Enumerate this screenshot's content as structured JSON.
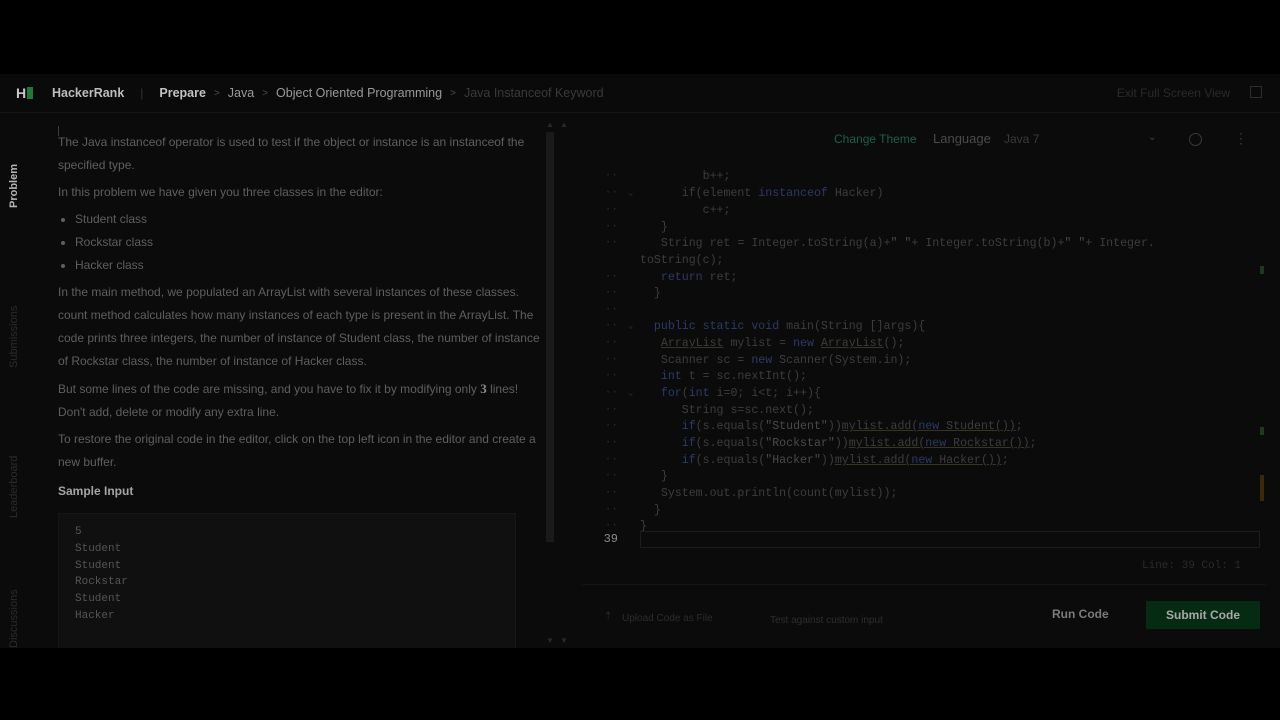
{
  "header": {
    "brand": "HackerRank",
    "logo_letter": "H",
    "breadcrumbs": [
      "Prepare",
      "Java",
      "Object Oriented Programming",
      "Java Instanceof Keyword"
    ],
    "exit_full_screen": "Exit Full Screen View"
  },
  "vtabs": [
    "Problem",
    "Submissions",
    "Leaderboard",
    "Discussions"
  ],
  "problem": {
    "p1": "The Java instanceof operator is used to test if the object or instance is an instanceof the specified type.",
    "p2": "In this problem we have given you three classes in the editor:",
    "classes": [
      "Student class",
      "Rockstar class",
      "Hacker class"
    ],
    "p3": "In the main method, we populated an ArrayList with several instances of these classes. count method calculates how many instances of each type is present in the ArrayList. The code prints three integers, the number of instance of Student class, the number of instance of Rockstar class, the number of instance of Hacker class.",
    "p4_a": "But some lines of the code are missing, and you have to fix it by modifying only ",
    "p4_num": "3",
    "p4_b": " lines! Don't add, delete or modify any extra line.",
    "p5": "To restore the original code in the editor, click on the top left icon in the editor and create a new buffer.",
    "sample_title": "Sample Input",
    "sample_lines": [
      "5",
      "Student",
      "Student",
      "Rockstar",
      "Student",
      "Hacker"
    ]
  },
  "editor": {
    "change_theme": "Change Theme",
    "language_label": "Language",
    "language_value": "Java 7",
    "current_line_number": "39",
    "status": "Line: 39 Col: 1",
    "upload": "Upload Code as File",
    "custom_input": "Test against custom input",
    "run": "Run Code",
    "submit": "Submit Code"
  },
  "colors": {
    "accent_green": "#1f7a3a",
    "submit_bg": "#062b13"
  }
}
